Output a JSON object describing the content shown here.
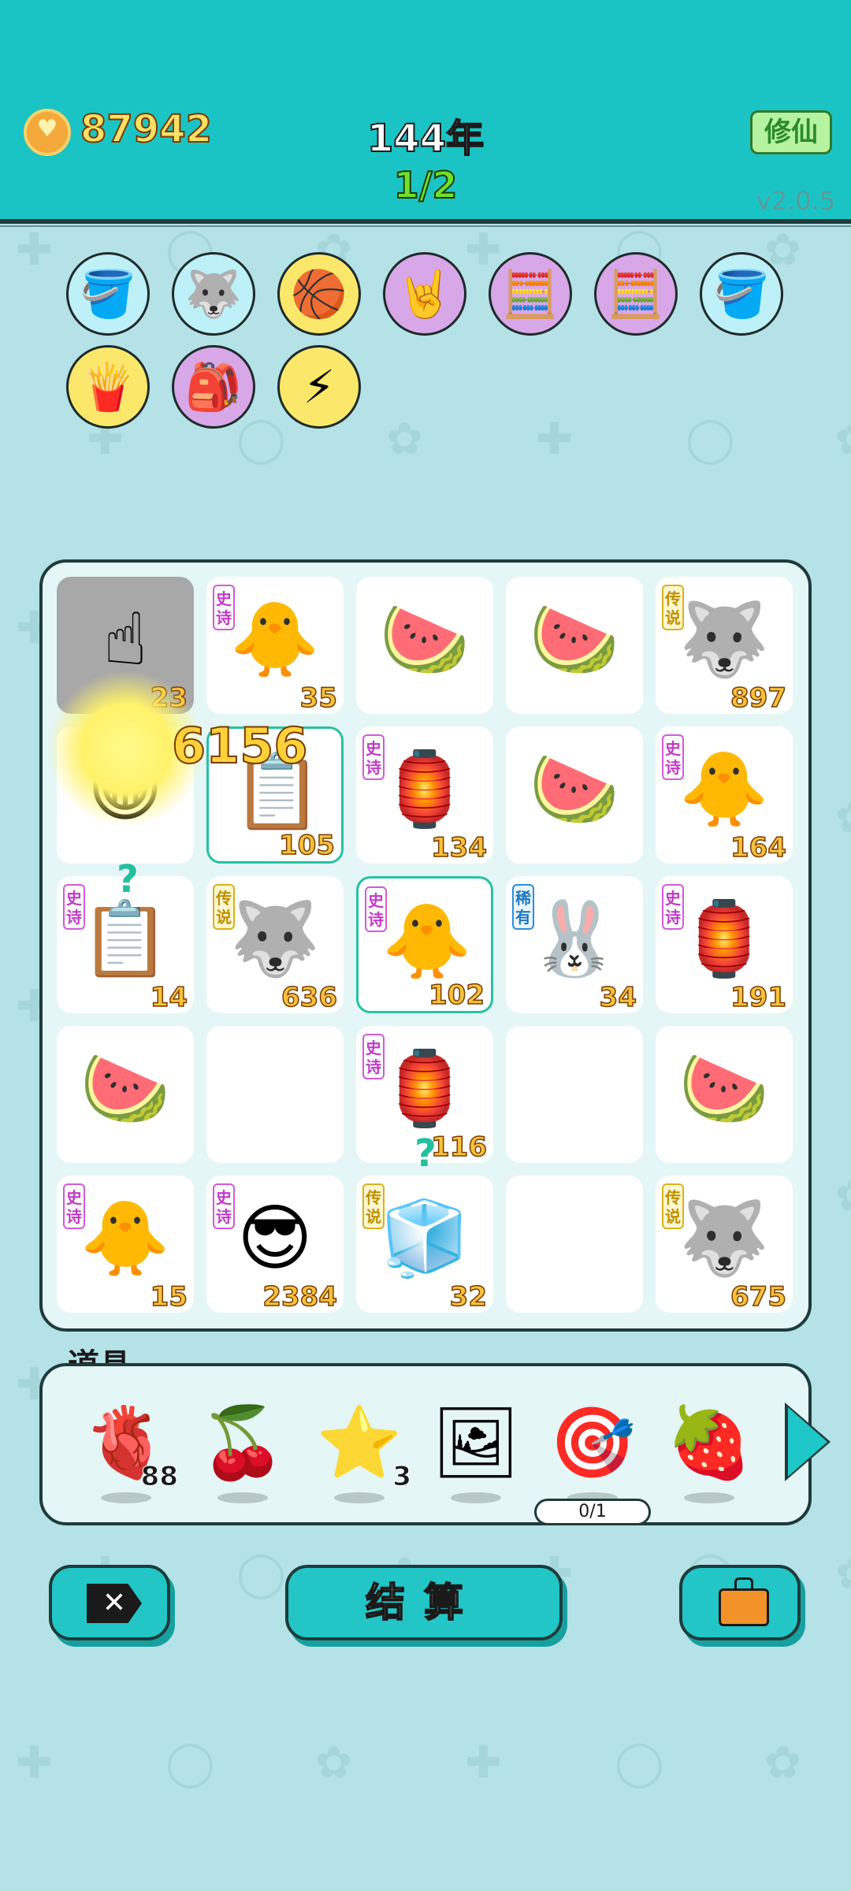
{
  "header": {
    "coins": "87942",
    "year": "144年",
    "wave": "1/2",
    "mode_button": "修仙",
    "version": "v2.0.5"
  },
  "buffs": [
    {
      "name": "pump-icon",
      "bg": "#bdf0f7"
    },
    {
      "name": "husky-icon",
      "bg": "#bdf0f7"
    },
    {
      "name": "basketballs-icon",
      "bg": "#fbe86a"
    },
    {
      "name": "rock-hand-icon",
      "bg": "#d8a7e8"
    },
    {
      "name": "math-head-icon",
      "bg": "#d8a7e8"
    },
    {
      "name": "math-head-icon",
      "bg": "#d8a7e8"
    },
    {
      "name": "pump-icon",
      "bg": "#bdf0f7"
    },
    {
      "name": "fries-icon",
      "bg": "#fbe86a"
    },
    {
      "name": "bindle-icon",
      "bg": "#d8a7e8"
    },
    {
      "name": "lightning-icon",
      "bg": "#fbe86a"
    }
  ],
  "board": {
    "damage_popup": "6156",
    "cells": [
      {
        "icon": "☝",
        "name": "pointing-hand-icon",
        "num": "23",
        "tag": "",
        "style": "gray"
      },
      {
        "icon": "🐥",
        "name": "gray-hair-chick-icon",
        "num": "35",
        "tag": "史诗",
        "style": ""
      },
      {
        "icon": "🍉",
        "name": "watermelon-icon",
        "num": "",
        "tag": "",
        "style": ""
      },
      {
        "icon": "🍉",
        "name": "watermelon-icon",
        "num": "",
        "tag": "",
        "style": ""
      },
      {
        "icon": "🐺",
        "name": "crowned-husky-icon",
        "num": "897",
        "tag": "传说",
        "style": ""
      },
      {
        "icon": "😁",
        "name": "grinning-face-icon",
        "num": "",
        "tag": "",
        "style": ""
      },
      {
        "icon": "📋",
        "name": "copy-paste-icon",
        "num": "105",
        "tag": "",
        "style": "selected"
      },
      {
        "icon": "🏮",
        "name": "rabbit-house-icon",
        "num": "134",
        "tag": "史诗",
        "style": ""
      },
      {
        "icon": "🍉",
        "name": "watermelon-icon",
        "num": "",
        "tag": "",
        "style": ""
      },
      {
        "icon": "🐥",
        "name": "gray-hair-chick-icon",
        "num": "164",
        "tag": "史诗",
        "style": ""
      },
      {
        "icon": "📋",
        "name": "copy-paste-icon",
        "num": "14",
        "tag": "史诗",
        "style": ""
      },
      {
        "icon": "🐺",
        "name": "crowned-husky-icon",
        "num": "636",
        "tag": "传说",
        "style": ""
      },
      {
        "icon": "🐥",
        "name": "gray-hair-chick-icon",
        "num": "102",
        "tag": "史诗",
        "style": "selected"
      },
      {
        "icon": "🐰",
        "name": "rabbit-icon",
        "num": "34",
        "tag": "稀有",
        "style": ""
      },
      {
        "icon": "🏮",
        "name": "rabbit-house-icon",
        "num": "191",
        "tag": "史诗",
        "style": ""
      },
      {
        "icon": "🍉",
        "name": "watermelon-icon",
        "num": "",
        "tag": "",
        "style": ""
      },
      {
        "icon": "",
        "name": "empty-slot",
        "num": "",
        "tag": "",
        "style": ""
      },
      {
        "icon": "🏮",
        "name": "rabbit-house-icon",
        "num": "116",
        "tag": "史诗",
        "style": ""
      },
      {
        "icon": "",
        "name": "empty-slot",
        "num": "",
        "tag": "",
        "style": ""
      },
      {
        "icon": "🍉",
        "name": "watermelon-icon",
        "num": "",
        "tag": "",
        "style": ""
      },
      {
        "icon": "🐥",
        "name": "gray-hair-chick-icon",
        "num": "15",
        "tag": "史诗",
        "style": ""
      },
      {
        "icon": "😎",
        "name": "green-hat-man-icon",
        "num": "2384",
        "tag": "史诗",
        "style": ""
      },
      {
        "icon": "🧊",
        "name": "clover-box-icon",
        "num": "32",
        "tag": "传说",
        "style": ""
      },
      {
        "icon": "",
        "name": "empty-slot",
        "num": "",
        "tag": "",
        "style": ""
      },
      {
        "icon": "🐺",
        "name": "crowned-husky-icon",
        "num": "675",
        "tag": "传说",
        "style": ""
      }
    ]
  },
  "items": {
    "label": "道具",
    "list": [
      {
        "icon": "🫀",
        "name": "liver-icon",
        "count": "88",
        "sub": ""
      },
      {
        "icon": "🍒",
        "name": "bayberry-icon",
        "count": "",
        "sub": ""
      },
      {
        "icon": "⭐",
        "name": "star-icon",
        "count": "3",
        "sub": ""
      },
      {
        "icon": "🖼",
        "name": "frame-icon",
        "count": "",
        "sub": ""
      },
      {
        "icon": "🎯",
        "name": "target-10-icon",
        "count": "",
        "sub": "0/1"
      },
      {
        "icon": "🍓",
        "name": "strawberry-icon",
        "count": "",
        "sub": ""
      }
    ]
  },
  "buttons": {
    "settle": "结算"
  }
}
